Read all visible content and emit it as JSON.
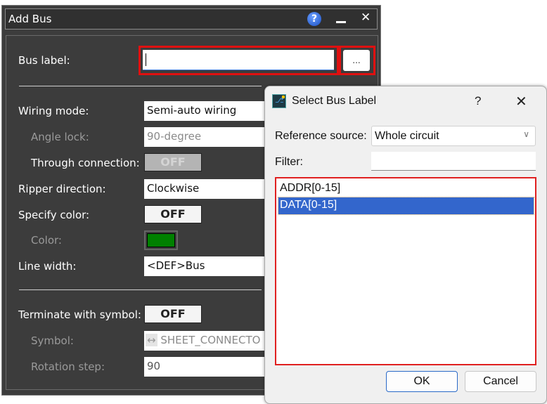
{
  "main_window": {
    "title": "Add Bus",
    "help_icon": "?",
    "close_icon": "✕",
    "bus_label": {
      "label": "Bus label:",
      "value": "",
      "browse_label": "..."
    },
    "wiring_mode": {
      "label": "Wiring mode:",
      "value": "Semi-auto wiring"
    },
    "angle_lock": {
      "label": "Angle lock:",
      "value": "90-degree"
    },
    "through_connection": {
      "label": "Through connection:",
      "value": "OFF"
    },
    "ripper_direction": {
      "label": "Ripper direction:",
      "value": "Clockwise"
    },
    "specify_color": {
      "label": "Specify color:",
      "value": "OFF"
    },
    "color": {
      "label": "Color:",
      "value": "#008000"
    },
    "line_width": {
      "label": "Line width:",
      "value": "<DEF>Bus"
    },
    "terminate_with_symbol": {
      "label": "Terminate with symbol:",
      "value": "OFF"
    },
    "symbol": {
      "label": "Symbol:",
      "value": "SHEET_CONNECTO",
      "icon": "↔"
    },
    "rotation_step": {
      "label": "Rotation step:",
      "value": "90"
    }
  },
  "dialog": {
    "title": "Select Bus Label",
    "help": "?",
    "close": "✕",
    "reference_source": {
      "label": "Reference source:",
      "value": "Whole circuit",
      "chevron": "∨"
    },
    "filter": {
      "label": "Filter:",
      "value": ""
    },
    "items": [
      {
        "label": "ADDR[0-15]",
        "selected": false
      },
      {
        "label": "DATA[0-15]",
        "selected": true
      }
    ],
    "ok_label": "OK",
    "cancel_label": "Cancel"
  }
}
